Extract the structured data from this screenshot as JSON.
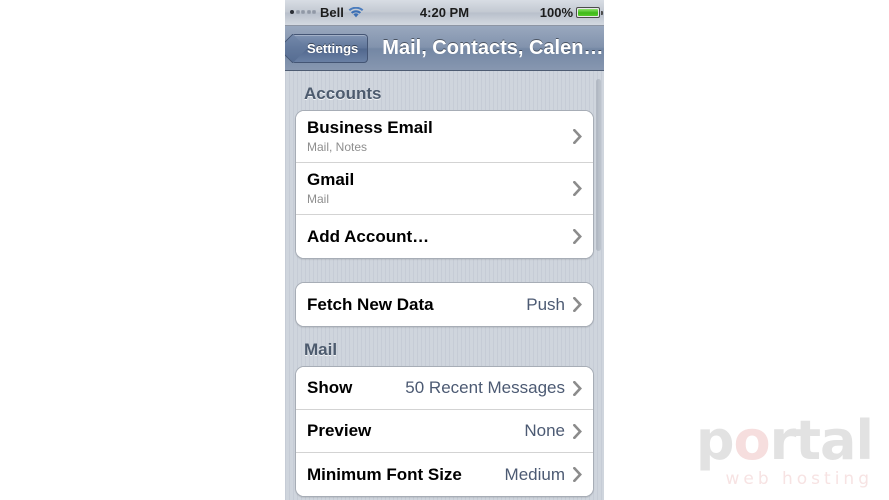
{
  "status_bar": {
    "carrier": "Bell",
    "signal_bars_filled": 1,
    "signal_bars_total": 5,
    "wifi_icon": "wifi-icon",
    "time": "4:20 PM",
    "battery_percent": "100%",
    "battery_level": 100,
    "battery_color": "#3eb918"
  },
  "nav_bar": {
    "back_label": "Settings",
    "title": "Mail, Contacts, Calen…"
  },
  "sections": [
    {
      "header": "Accounts",
      "rows": [
        {
          "title": "Business Email",
          "subtitle": "Mail, Notes",
          "value": "",
          "chevron": true
        },
        {
          "title": "Gmail",
          "subtitle": "Mail",
          "value": "",
          "chevron": true
        },
        {
          "title": "Add Account…",
          "subtitle": "",
          "value": "",
          "chevron": true
        }
      ]
    },
    {
      "header": "",
      "rows": [
        {
          "title": "Fetch New Data",
          "subtitle": "",
          "value": "Push",
          "chevron": true
        }
      ]
    },
    {
      "header": "Mail",
      "rows": [
        {
          "title": "Show",
          "subtitle": "",
          "value": "50 Recent Messages",
          "chevron": true
        },
        {
          "title": "Preview",
          "subtitle": "",
          "value": "None",
          "chevron": true
        },
        {
          "title": "Minimum Font Size",
          "subtitle": "",
          "value": "Medium",
          "chevron": true
        }
      ]
    }
  ],
  "watermark": {
    "brand_part1": "p",
    "brand_o": "o",
    "brand_part2": "rtal",
    "tagline": "web hosting",
    "brand_color": "#e2e2e2",
    "accent_color": "#f3d9d9"
  }
}
